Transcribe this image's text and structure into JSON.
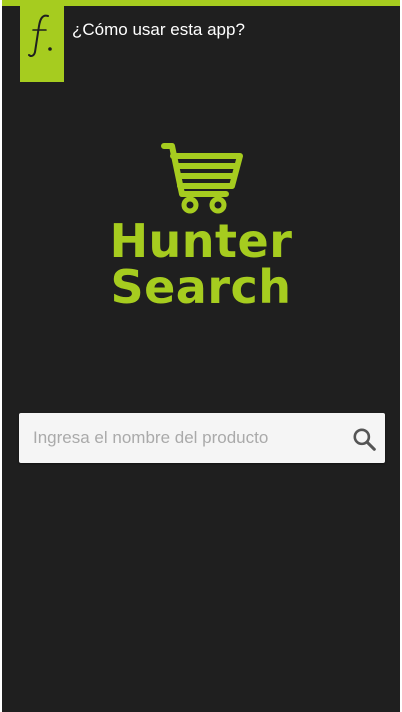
{
  "header": {
    "logo_letter": "f.",
    "help_link": "¿Cómo usar esta app?"
  },
  "brand": {
    "line1": "Hunter",
    "line2": "Search"
  },
  "search": {
    "placeholder": "Ingresa el nombre del producto",
    "value": ""
  },
  "colors": {
    "accent": "#a6cc1f",
    "background": "#1f1f1f"
  },
  "icons": [
    "f-logo-icon",
    "shopping-cart-icon",
    "search-icon"
  ]
}
